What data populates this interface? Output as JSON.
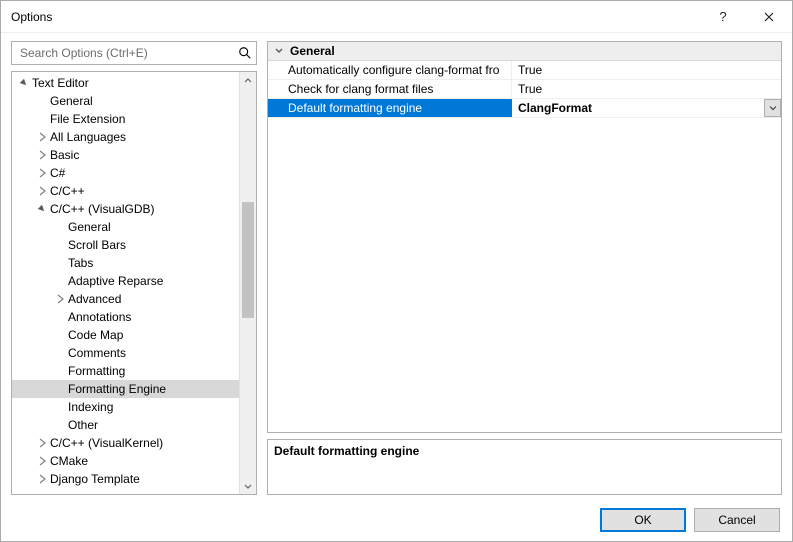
{
  "window": {
    "title": "Options"
  },
  "search": {
    "placeholder": "Search Options (Ctrl+E)"
  },
  "tree": {
    "items": [
      {
        "label": "Text Editor",
        "level": 0,
        "toggle": "open",
        "selected": false
      },
      {
        "label": "General",
        "level": 1,
        "toggle": "none",
        "selected": false
      },
      {
        "label": "File Extension",
        "level": 1,
        "toggle": "none",
        "selected": false
      },
      {
        "label": "All Languages",
        "level": 1,
        "toggle": "closed",
        "selected": false
      },
      {
        "label": "Basic",
        "level": 1,
        "toggle": "closed",
        "selected": false
      },
      {
        "label": "C#",
        "level": 1,
        "toggle": "closed",
        "selected": false
      },
      {
        "label": "C/C++",
        "level": 1,
        "toggle": "closed",
        "selected": false
      },
      {
        "label": "C/C++ (VisualGDB)",
        "level": 1,
        "toggle": "open",
        "selected": false
      },
      {
        "label": "General",
        "level": 2,
        "toggle": "none",
        "selected": false
      },
      {
        "label": "Scroll Bars",
        "level": 2,
        "toggle": "none",
        "selected": false
      },
      {
        "label": "Tabs",
        "level": 2,
        "toggle": "none",
        "selected": false
      },
      {
        "label": "Adaptive Reparse",
        "level": 2,
        "toggle": "none",
        "selected": false
      },
      {
        "label": "Advanced",
        "level": 2,
        "toggle": "closed",
        "selected": false
      },
      {
        "label": "Annotations",
        "level": 2,
        "toggle": "none",
        "selected": false
      },
      {
        "label": "Code Map",
        "level": 2,
        "toggle": "none",
        "selected": false
      },
      {
        "label": "Comments",
        "level": 2,
        "toggle": "none",
        "selected": false
      },
      {
        "label": "Formatting",
        "level": 2,
        "toggle": "none",
        "selected": false
      },
      {
        "label": "Formatting Engine",
        "level": 2,
        "toggle": "none",
        "selected": true
      },
      {
        "label": "Indexing",
        "level": 2,
        "toggle": "none",
        "selected": false
      },
      {
        "label": "Other",
        "level": 2,
        "toggle": "none",
        "selected": false
      },
      {
        "label": "C/C++ (VisualKernel)",
        "level": 1,
        "toggle": "closed",
        "selected": false
      },
      {
        "label": "CMake",
        "level": 1,
        "toggle": "closed",
        "selected": false
      },
      {
        "label": "Django Template",
        "level": 1,
        "toggle": "closed",
        "selected": false
      }
    ],
    "scroll": {
      "thumb_top_pct": 29,
      "thumb_height_pct": 30
    }
  },
  "property_grid": {
    "group": "General",
    "rows": [
      {
        "name": "Automatically configure clang-format fro",
        "value": "True",
        "selected": false,
        "dropdown": false
      },
      {
        "name": "Check for clang format files",
        "value": "True",
        "selected": false,
        "dropdown": false
      },
      {
        "name": "Default formatting engine",
        "value": "ClangFormat",
        "selected": true,
        "dropdown": true
      }
    ]
  },
  "description": {
    "title": "Default formatting engine",
    "body": ""
  },
  "buttons": {
    "ok": "OK",
    "cancel": "Cancel"
  }
}
